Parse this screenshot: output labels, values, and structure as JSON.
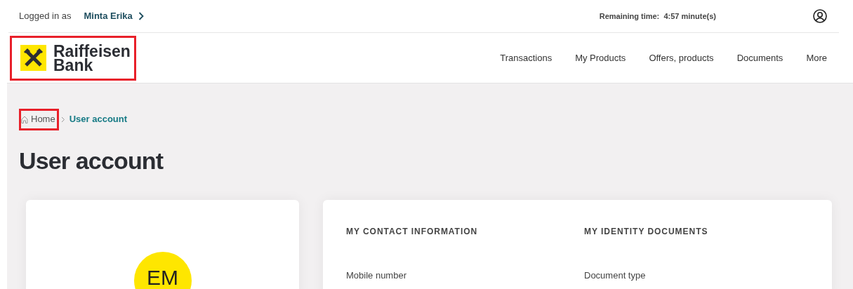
{
  "top_bar": {
    "logged_in_label": "Logged in as",
    "user_name": "Minta Erika",
    "remaining_label": "Remaining time:",
    "remaining_value": "4:57 minute(s)"
  },
  "header": {
    "logo": {
      "line_1": "Raiffeisen",
      "line_2": "Bank",
      "highlighted": true
    },
    "nav": [
      "Transactions",
      "My Products",
      "Offers, products",
      "Documents",
      "More"
    ]
  },
  "breadcrumb": [
    {
      "label": "Home",
      "kind": "home",
      "highlighted": true
    },
    {
      "label": "User account",
      "kind": "current",
      "highlighted": false
    }
  ],
  "page_title": "User account",
  "profile_card": {
    "initials": "EM"
  },
  "info_card": {
    "sections": [
      {
        "heading": "MY CONTACT INFORMATION",
        "field_label": "Mobile number"
      },
      {
        "heading": "MY IDENTITY DOCUMENTS",
        "field_label": "Document type"
      }
    ]
  }
}
